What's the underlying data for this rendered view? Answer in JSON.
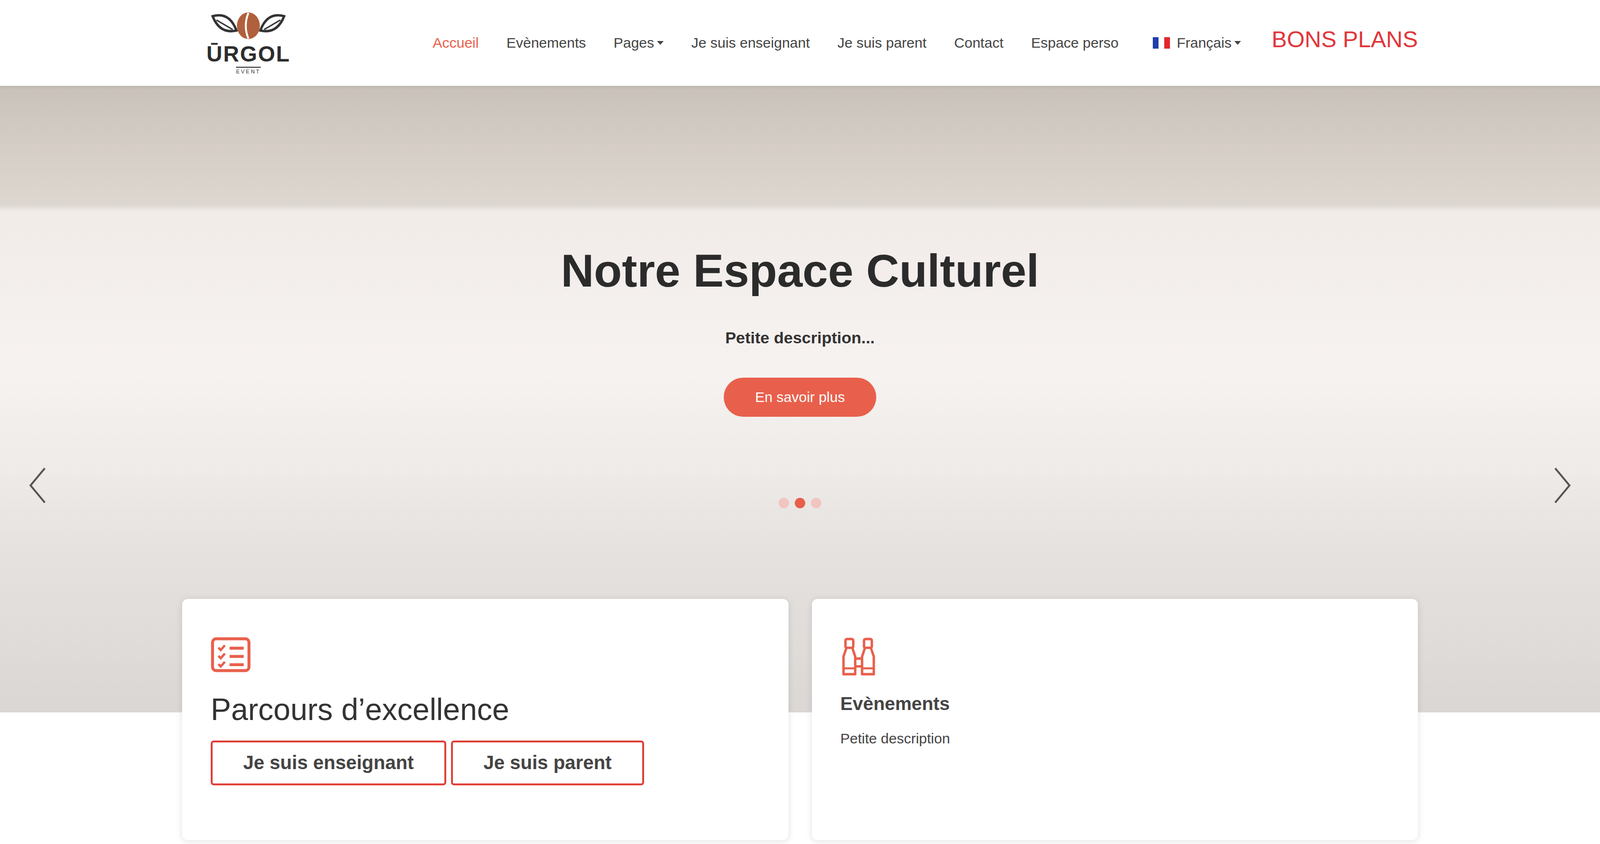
{
  "header": {
    "logo": {
      "name": "ŪRGOL",
      "tagline": "EVENT"
    },
    "nav": [
      {
        "label": "Accueil",
        "selected": true,
        "dropdown": false
      },
      {
        "label": "Evènements",
        "selected": false,
        "dropdown": false
      },
      {
        "label": "Pages",
        "selected": false,
        "dropdown": true
      },
      {
        "label": "Je suis enseignant",
        "selected": false,
        "dropdown": false
      },
      {
        "label": "Je suis parent",
        "selected": false,
        "dropdown": false
      },
      {
        "label": "Contact",
        "selected": false,
        "dropdown": false
      },
      {
        "label": "Espace perso",
        "selected": false,
        "dropdown": false
      }
    ],
    "language": {
      "label": "Français",
      "dropdown": true
    },
    "promo": "BONS PLANS"
  },
  "hero": {
    "title": "Notre Espace Culturel",
    "description": "Petite description...",
    "button": "En savoir plus",
    "slides": [
      {
        "selected": false
      },
      {
        "selected": true
      },
      {
        "selected": false
      }
    ]
  },
  "cards": [
    {
      "kind": "buttons",
      "title": "Parcours d’excellence",
      "buttons": [
        "Je suis enseignant",
        "Je suis parent"
      ]
    },
    {
      "kind": "text",
      "title": "Evènements",
      "description": "Petite description"
    }
  ]
}
